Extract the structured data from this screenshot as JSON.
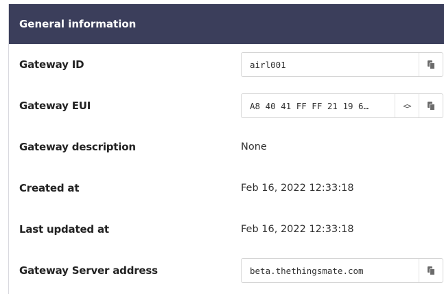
{
  "panel": {
    "title": "General information"
  },
  "rows": [
    {
      "label": "Gateway ID",
      "value": "airl001",
      "type": "copy-field"
    },
    {
      "label": "Gateway EUI",
      "value": "A8 40 41 FF FF 21 19 6…",
      "type": "eui-field",
      "toggle_glyph": "<>"
    },
    {
      "label": "Gateway description",
      "value": "None",
      "type": "text"
    },
    {
      "label": "Created at",
      "value": "Feb 16, 2022 12:33:18",
      "type": "text"
    },
    {
      "label": "Last updated at",
      "value": "Feb 16, 2022 12:33:18",
      "type": "text"
    },
    {
      "label": "Gateway Server address",
      "value": "beta.thethingsmate.com",
      "type": "copy-field"
    }
  ],
  "icons": {
    "copy": "copy-icon",
    "toggle": "code-toggle-icon"
  },
  "colors": {
    "header_bg": "#3b3e5b",
    "header_text": "#ffffff"
  }
}
